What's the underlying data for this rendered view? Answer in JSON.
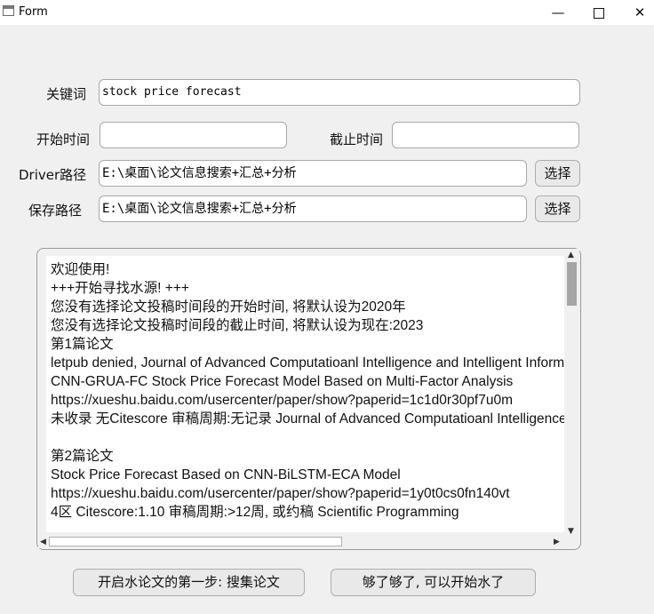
{
  "window": {
    "title": "Form",
    "minimize_glyph": "—",
    "close_glyph": "✕"
  },
  "form": {
    "keyword_label": "关键词",
    "keyword_value": "stock price forecast",
    "start_label": "开始时间",
    "start_value": "",
    "end_label": "截止时间",
    "end_value": "",
    "driver_label": "Driver路径",
    "driver_value": "E:\\桌面\\论文信息搜索+汇总+分析",
    "driver_button": "选择",
    "save_label": "保存路径",
    "save_value": "E:\\桌面\\论文信息搜索+汇总+分析",
    "save_button": "选择"
  },
  "log": {
    "lines": [
      "欢迎使用!",
      "+++开始寻找水源! +++",
      "您没有选择论文投稿时间段的开始时间, 将默认设为2020年",
      "您没有选择论文投稿时间段的截止时间, 将默认设为现在:2023",
      "第1篇论文",
      "letpub denied, Journal of Advanced Computatioanl Intelligence and Intelligent Informatics",
      "CNN-GRUA-FC Stock Price Forecast Model Based on Multi-Factor Analysis",
      "https://xueshu.baidu.com/usercenter/paper/show?paperid=1c1d0r30pf7u0m",
      "未收录 无Citescore 审稿周期:无记录 Journal of Advanced Computatioanl Intelligence",
      "",
      "第2篇论文",
      "Stock Price Forecast Based on CNN-BiLSTM-ECA Model",
      "https://xueshu.baidu.com/usercenter/paper/show?paperid=1y0t0cs0fn140vt",
      "4区 Citescore:1.10 审稿周期:>12周, 或约稿 Scientific Programming"
    ]
  },
  "actions": {
    "collect_button": "开启水论文的第一步: 搜集论文",
    "start_button": "够了够了, 可以开始水了"
  }
}
